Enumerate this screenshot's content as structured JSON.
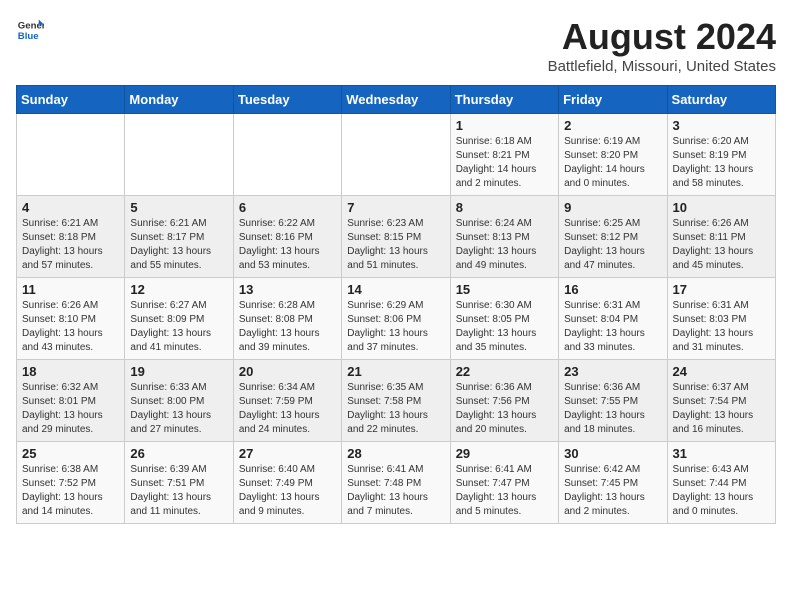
{
  "header": {
    "logo_general": "General",
    "logo_blue": "Blue",
    "title": "August 2024",
    "subtitle": "Battlefield, Missouri, United States"
  },
  "calendar": {
    "weekdays": [
      "Sunday",
      "Monday",
      "Tuesday",
      "Wednesday",
      "Thursday",
      "Friday",
      "Saturday"
    ],
    "weeks": [
      [
        {
          "day": "",
          "info": ""
        },
        {
          "day": "",
          "info": ""
        },
        {
          "day": "",
          "info": ""
        },
        {
          "day": "",
          "info": ""
        },
        {
          "day": "1",
          "info": "Sunrise: 6:18 AM\nSunset: 8:21 PM\nDaylight: 14 hours\nand 2 minutes."
        },
        {
          "day": "2",
          "info": "Sunrise: 6:19 AM\nSunset: 8:20 PM\nDaylight: 14 hours\nand 0 minutes."
        },
        {
          "day": "3",
          "info": "Sunrise: 6:20 AM\nSunset: 8:19 PM\nDaylight: 13 hours\nand 58 minutes."
        }
      ],
      [
        {
          "day": "4",
          "info": "Sunrise: 6:21 AM\nSunset: 8:18 PM\nDaylight: 13 hours\nand 57 minutes."
        },
        {
          "day": "5",
          "info": "Sunrise: 6:21 AM\nSunset: 8:17 PM\nDaylight: 13 hours\nand 55 minutes."
        },
        {
          "day": "6",
          "info": "Sunrise: 6:22 AM\nSunset: 8:16 PM\nDaylight: 13 hours\nand 53 minutes."
        },
        {
          "day": "7",
          "info": "Sunrise: 6:23 AM\nSunset: 8:15 PM\nDaylight: 13 hours\nand 51 minutes."
        },
        {
          "day": "8",
          "info": "Sunrise: 6:24 AM\nSunset: 8:13 PM\nDaylight: 13 hours\nand 49 minutes."
        },
        {
          "day": "9",
          "info": "Sunrise: 6:25 AM\nSunset: 8:12 PM\nDaylight: 13 hours\nand 47 minutes."
        },
        {
          "day": "10",
          "info": "Sunrise: 6:26 AM\nSunset: 8:11 PM\nDaylight: 13 hours\nand 45 minutes."
        }
      ],
      [
        {
          "day": "11",
          "info": "Sunrise: 6:26 AM\nSunset: 8:10 PM\nDaylight: 13 hours\nand 43 minutes."
        },
        {
          "day": "12",
          "info": "Sunrise: 6:27 AM\nSunset: 8:09 PM\nDaylight: 13 hours\nand 41 minutes."
        },
        {
          "day": "13",
          "info": "Sunrise: 6:28 AM\nSunset: 8:08 PM\nDaylight: 13 hours\nand 39 minutes."
        },
        {
          "day": "14",
          "info": "Sunrise: 6:29 AM\nSunset: 8:06 PM\nDaylight: 13 hours\nand 37 minutes."
        },
        {
          "day": "15",
          "info": "Sunrise: 6:30 AM\nSunset: 8:05 PM\nDaylight: 13 hours\nand 35 minutes."
        },
        {
          "day": "16",
          "info": "Sunrise: 6:31 AM\nSunset: 8:04 PM\nDaylight: 13 hours\nand 33 minutes."
        },
        {
          "day": "17",
          "info": "Sunrise: 6:31 AM\nSunset: 8:03 PM\nDaylight: 13 hours\nand 31 minutes."
        }
      ],
      [
        {
          "day": "18",
          "info": "Sunrise: 6:32 AM\nSunset: 8:01 PM\nDaylight: 13 hours\nand 29 minutes."
        },
        {
          "day": "19",
          "info": "Sunrise: 6:33 AM\nSunset: 8:00 PM\nDaylight: 13 hours\nand 27 minutes."
        },
        {
          "day": "20",
          "info": "Sunrise: 6:34 AM\nSunset: 7:59 PM\nDaylight: 13 hours\nand 24 minutes."
        },
        {
          "day": "21",
          "info": "Sunrise: 6:35 AM\nSunset: 7:58 PM\nDaylight: 13 hours\nand 22 minutes."
        },
        {
          "day": "22",
          "info": "Sunrise: 6:36 AM\nSunset: 7:56 PM\nDaylight: 13 hours\nand 20 minutes."
        },
        {
          "day": "23",
          "info": "Sunrise: 6:36 AM\nSunset: 7:55 PM\nDaylight: 13 hours\nand 18 minutes."
        },
        {
          "day": "24",
          "info": "Sunrise: 6:37 AM\nSunset: 7:54 PM\nDaylight: 13 hours\nand 16 minutes."
        }
      ],
      [
        {
          "day": "25",
          "info": "Sunrise: 6:38 AM\nSunset: 7:52 PM\nDaylight: 13 hours\nand 14 minutes."
        },
        {
          "day": "26",
          "info": "Sunrise: 6:39 AM\nSunset: 7:51 PM\nDaylight: 13 hours\nand 11 minutes."
        },
        {
          "day": "27",
          "info": "Sunrise: 6:40 AM\nSunset: 7:49 PM\nDaylight: 13 hours\nand 9 minutes."
        },
        {
          "day": "28",
          "info": "Sunrise: 6:41 AM\nSunset: 7:48 PM\nDaylight: 13 hours\nand 7 minutes."
        },
        {
          "day": "29",
          "info": "Sunrise: 6:41 AM\nSunset: 7:47 PM\nDaylight: 13 hours\nand 5 minutes."
        },
        {
          "day": "30",
          "info": "Sunrise: 6:42 AM\nSunset: 7:45 PM\nDaylight: 13 hours\nand 2 minutes."
        },
        {
          "day": "31",
          "info": "Sunrise: 6:43 AM\nSunset: 7:44 PM\nDaylight: 13 hours\nand 0 minutes."
        }
      ]
    ]
  }
}
